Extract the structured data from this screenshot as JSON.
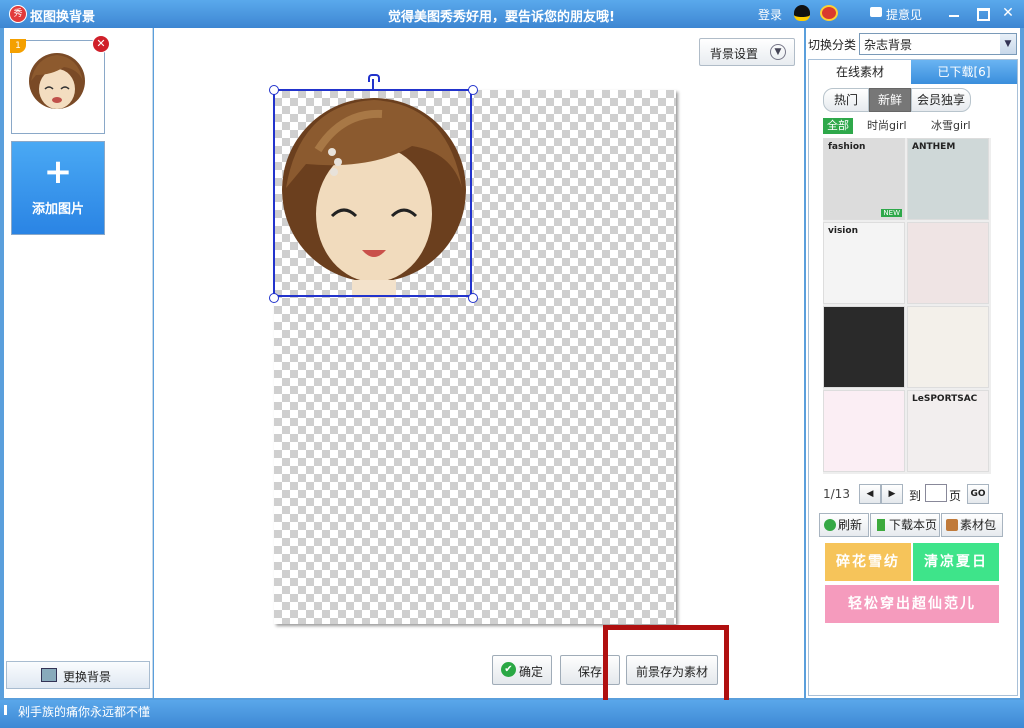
{
  "window": {
    "title": "抠图换背景",
    "slogan": "觉得美图秀秀好用，要告诉您的朋友哦!",
    "login": "登录",
    "feedback": "提意见",
    "app_icon_text": "秀"
  },
  "left": {
    "thumb_badge": "1",
    "add_label": "添加图片",
    "change_bg": "更换背景"
  },
  "canvas": {
    "bg_settings": "背景设置",
    "confirm": "确定",
    "save": "保存",
    "save_material": "前景存为素材"
  },
  "right": {
    "category_label": "切换分类",
    "category_value": "杂志背景",
    "tabs": [
      "在线素材",
      "已下载[6]"
    ],
    "segments": [
      "热门",
      "新鲜",
      "会员独享"
    ],
    "subcategories": [
      "全部",
      "时尚girl",
      "冰雪girl"
    ],
    "tiles": [
      {
        "caption": "fashion",
        "bg": "#dcdcdc",
        "badge": "NEW"
      },
      {
        "caption": "ANTHEM",
        "bg": "#cfd8d8"
      },
      {
        "caption": "vision",
        "bg": "#f4f4f4"
      },
      {
        "caption": "",
        "bg": "#efe4e4"
      },
      {
        "caption": "",
        "bg": "#2a2a2a"
      },
      {
        "caption": "",
        "bg": "#f3f0ea"
      },
      {
        "caption": "",
        "bg": "#fbeef4"
      },
      {
        "caption": "LeSPORTSAC",
        "bg": "#f2eeee"
      }
    ],
    "pager": {
      "count": "1/13",
      "to": "到",
      "page": "页",
      "go": "GO"
    },
    "tools": [
      "刷新",
      "下载本页",
      "素材包"
    ],
    "promos": [
      "碎花雪纺",
      "清凉夏日",
      "轻松穿出超仙范儿"
    ]
  },
  "status": {
    "text": "剁手族的痛你永远都不懂"
  },
  "colors": {
    "accent": "#3d86d2",
    "highlight": "#b01010",
    "selection": "#2233cc"
  }
}
